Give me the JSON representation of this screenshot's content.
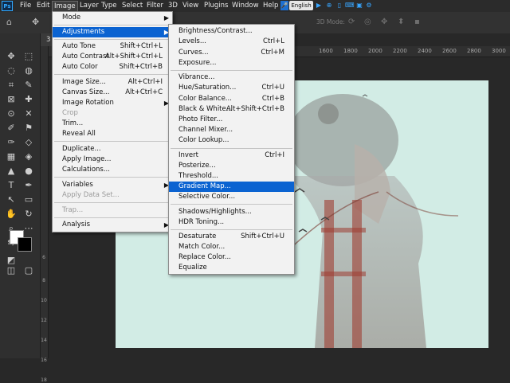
{
  "menubar": {
    "items": [
      "File",
      "Edit",
      "Image",
      "Layer",
      "Type",
      "Select",
      "Filter",
      "3D",
      "View",
      "Plugins",
      "Window",
      "Help"
    ],
    "language": "English",
    "logo": "Ps"
  },
  "options_bar": {
    "three_d_mode": "3D Mode:"
  },
  "document": {
    "tab_partial": "3",
    "ruler_top_labels": [
      "1600",
      "1800",
      "2000",
      "2200",
      "2400",
      "2600",
      "2800",
      "3000"
    ],
    "ruler_left_labels": [
      "6",
      "8",
      "10",
      "12",
      "14",
      "16",
      "18"
    ]
  },
  "image_menu": {
    "items": [
      {
        "label": "Mode",
        "submenu": true
      },
      {
        "separator": true
      },
      {
        "label": "Adjustments",
        "submenu": true,
        "highlighted": true
      },
      {
        "separator": true
      },
      {
        "label": "Auto Tone",
        "shortcut": "Shift+Ctrl+L"
      },
      {
        "label": "Auto Contrast",
        "shortcut": "Alt+Shift+Ctrl+L"
      },
      {
        "label": "Auto Color",
        "shortcut": "Shift+Ctrl+B"
      },
      {
        "separator": true
      },
      {
        "label": "Image Size...",
        "shortcut": "Alt+Ctrl+I"
      },
      {
        "label": "Canvas Size...",
        "shortcut": "Alt+Ctrl+C"
      },
      {
        "label": "Image Rotation",
        "submenu": true
      },
      {
        "label": "Crop",
        "disabled": true
      },
      {
        "label": "Trim..."
      },
      {
        "label": "Reveal All"
      },
      {
        "separator": true
      },
      {
        "label": "Duplicate..."
      },
      {
        "label": "Apply Image..."
      },
      {
        "label": "Calculations..."
      },
      {
        "separator": true
      },
      {
        "label": "Variables",
        "submenu": true
      },
      {
        "label": "Apply Data Set...",
        "disabled": true
      },
      {
        "separator": true
      },
      {
        "label": "Trap...",
        "disabled": true
      },
      {
        "separator": true
      },
      {
        "label": "Analysis",
        "submenu": true
      }
    ]
  },
  "adjustments_menu": {
    "items": [
      {
        "label": "Brightness/Contrast..."
      },
      {
        "label": "Levels...",
        "shortcut": "Ctrl+L"
      },
      {
        "label": "Curves...",
        "shortcut": "Ctrl+M"
      },
      {
        "label": "Exposure..."
      },
      {
        "separator": true
      },
      {
        "label": "Vibrance..."
      },
      {
        "label": "Hue/Saturation...",
        "shortcut": "Ctrl+U"
      },
      {
        "label": "Color Balance...",
        "shortcut": "Ctrl+B"
      },
      {
        "label": "Black & White...",
        "shortcut": "Alt+Shift+Ctrl+B"
      },
      {
        "label": "Photo Filter..."
      },
      {
        "label": "Channel Mixer..."
      },
      {
        "label": "Color Lookup..."
      },
      {
        "separator": true
      },
      {
        "label": "Invert",
        "shortcut": "Ctrl+I"
      },
      {
        "label": "Posterize..."
      },
      {
        "label": "Threshold..."
      },
      {
        "label": "Gradient Map...",
        "highlighted": true
      },
      {
        "label": "Selective Color..."
      },
      {
        "separator": true
      },
      {
        "label": "Shadows/Highlights..."
      },
      {
        "label": "HDR Toning..."
      },
      {
        "separator": true
      },
      {
        "label": "Desaturate",
        "shortcut": "Shift+Ctrl+U"
      },
      {
        "label": "Match Color..."
      },
      {
        "label": "Replace Color..."
      },
      {
        "label": "Equalize"
      }
    ]
  },
  "colors": {
    "highlight": "#0b63d1",
    "canvas": "#d2ece5",
    "accent": "#31a8ff"
  }
}
